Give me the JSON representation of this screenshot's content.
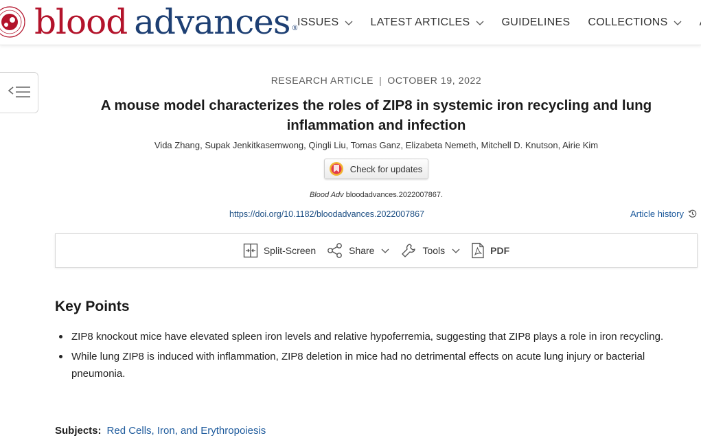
{
  "header": {
    "logo_word_1": "blood",
    "logo_word_2": "advances",
    "logo_reg": "®",
    "nav": [
      "ISSUES",
      "LATEST ARTICLES",
      "GUIDELINES",
      "COLLECTIONS",
      "A"
    ]
  },
  "article": {
    "type": "RESEARCH ARTICLE",
    "separator": "|",
    "date": "OCTOBER 19, 2022",
    "title": "A mouse model characterizes the roles of ZIP8 in systemic iron recycling and lung inflammation and infection",
    "authors": "Vida Zhang, Supak Jenkitkasemwong, Qingli Liu, Tomas Ganz, Elizabeta Nemeth, Mitchell D. Knutson, Airie Kim",
    "check_updates": "Check for updates",
    "journal_abbrev": "Blood Adv",
    "journal_id": " bloodadvances.2022007867.",
    "doi": "https://doi.org/10.1182/bloodadvances.2022007867",
    "history": "Article history"
  },
  "toolbar": {
    "split_screen": "Split-Screen",
    "share": "Share",
    "tools": "Tools",
    "pdf": "PDF"
  },
  "key_points": {
    "heading": "Key Points",
    "items": [
      "ZIP8 knockout mice have elevated spleen iron levels and relative hypoferremia, suggesting that ZIP8 plays a role in iron recycling.",
      "While lung ZIP8 is induced with inflammation, ZIP8 deletion in mice had no detrimental effects on acute lung injury or bacterial pneumonia."
    ]
  },
  "subjects": {
    "label": "Subjects:",
    "value": "Red Cells, Iron, and Erythropoiesis"
  },
  "colors": {
    "brand_red": "#b3132b",
    "brand_navy": "#1d3f73",
    "link": "#1d5a9c"
  }
}
